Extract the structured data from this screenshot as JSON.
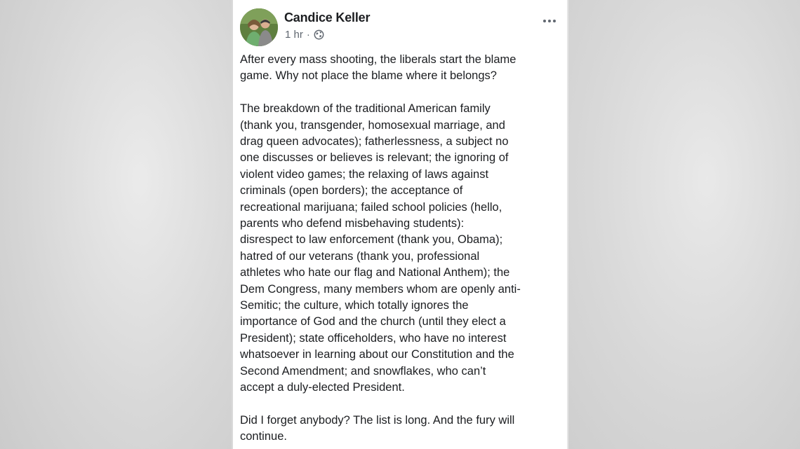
{
  "post": {
    "author": "Candice Keller",
    "time": "1 hr",
    "separator": "·",
    "privacy_icon": "globe-icon",
    "more_icon": "more-options-icon",
    "paragraphs": [
      "After every mass shooting, the liberals start the blame\ngame. Why not place the blame where it belongs?",
      "The breakdown of the traditional American family\n(thank you, transgender, homosexual marriage, and\ndrag queen advocates); fatherlessness, a subject no\none discusses or believes is relevant; the ignoring of\nviolent video games; the relaxing of laws against\ncriminals (open borders); the acceptance of\nrecreational marijuana; failed school policies (hello,\nparents who defend misbehaving students):\ndisrespect to law enforcement (thank you, Obama);\nhatred of our veterans (thank you, professional\nathletes who hate our flag and National Anthem); the\nDem Congress, many members whom are openly anti-\nSemitic; the culture, which totally ignores the\nimportance of God and the church (until they elect a\nPresident); state officeholders, who have no interest\nwhatsoever in learning about our Constitution and the\nSecond Amendment; and snowflakes, who can’t\naccept a duly-elected President.",
      "Did I forget anybody? The list is long. And the fury will\ncontinue."
    ]
  }
}
